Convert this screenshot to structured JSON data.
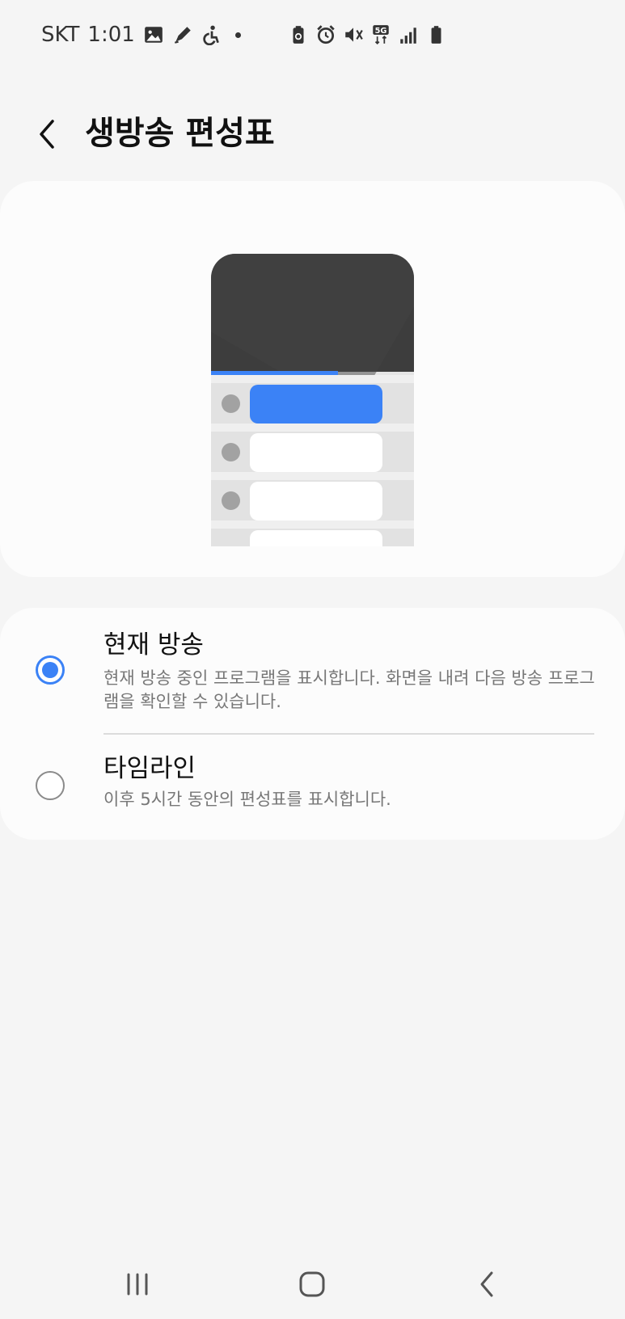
{
  "status_bar": {
    "carrier": "SKT",
    "time": "1:01",
    "network": "5G",
    "icons_left": [
      "gallery-icon",
      "pen-icon",
      "accessibility-icon",
      "dot-icon"
    ],
    "icons_right": [
      "battery-saver-icon",
      "alarm-icon",
      "mute-icon",
      "network-5g-icon",
      "signal-icon",
      "battery-icon"
    ]
  },
  "header": {
    "title": "생방송 편성표",
    "back_icon": "chevron-left-icon"
  },
  "options": [
    {
      "title": "현재 방송",
      "description": "현재 방송 중인 프로그램을 표시합니다. 화면을 내려 다음 방송 프로그램을 확인할 수 있습니다.",
      "selected": true
    },
    {
      "title": "타임라인",
      "description": "이후 5시간 동안의 편성표를 표시합니다.",
      "selected": false
    }
  ],
  "nav_bar": {
    "recents_icon": "recents-icon",
    "home_icon": "home-icon",
    "back_icon": "back-icon"
  },
  "colors": {
    "accent": "#3b82f6",
    "background": "#f5f5f5",
    "card": "#fcfcfc"
  }
}
